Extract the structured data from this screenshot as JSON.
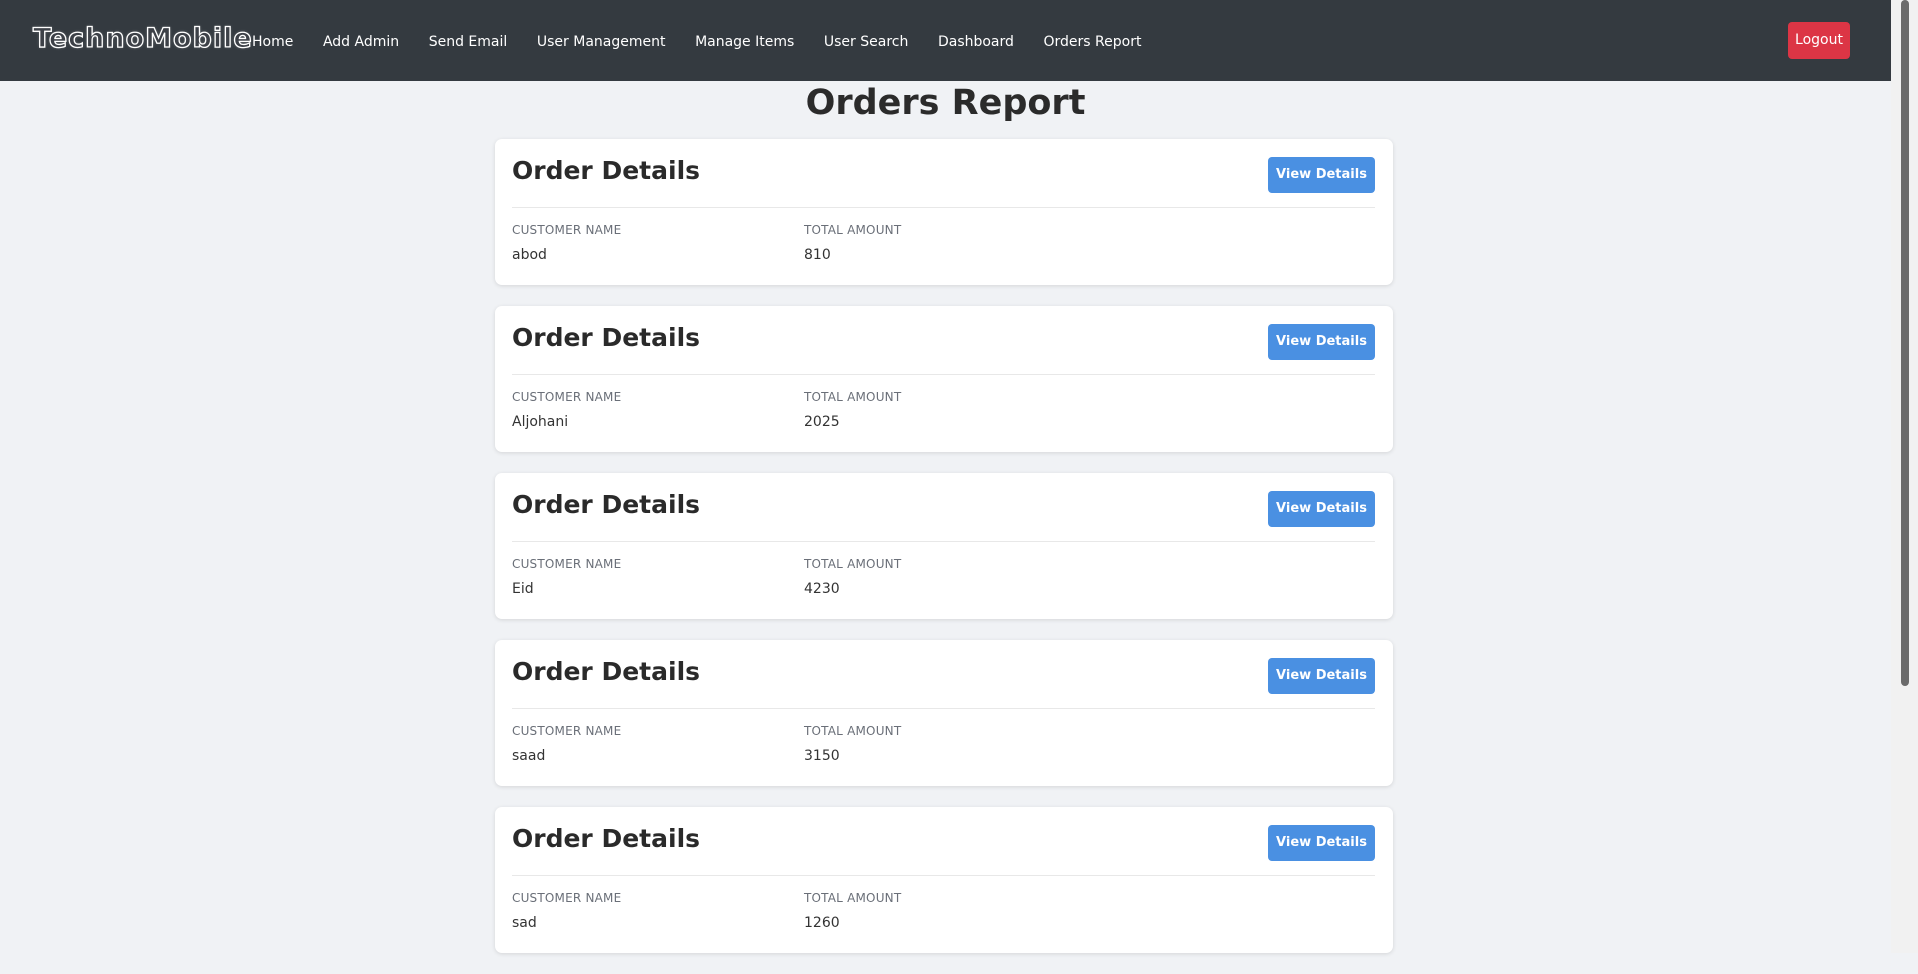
{
  "navbar": {
    "brand": "TechnoMobile",
    "links": [
      "Home",
      "Add Admin",
      "Send Email",
      "User Management",
      "Manage Items",
      "User Search",
      "Dashboard",
      "Orders Report"
    ],
    "logout_label": "Logout"
  },
  "page": {
    "title": "Orders Report"
  },
  "orders": [
    {
      "title": "Order Details",
      "button": "View Details",
      "customer_label": "CUSTOMER NAME",
      "customer": "abod",
      "amount_label": "TOTAL AMOUNT",
      "amount": "810"
    },
    {
      "title": "Order Details",
      "button": "View Details",
      "customer_label": "CUSTOMER NAME",
      "customer": "Aljohani",
      "amount_label": "TOTAL AMOUNT",
      "amount": "2025"
    },
    {
      "title": "Order Details",
      "button": "View Details",
      "customer_label": "CUSTOMER NAME",
      "customer": "Eid",
      "amount_label": "TOTAL AMOUNT",
      "amount": "4230"
    },
    {
      "title": "Order Details",
      "button": "View Details",
      "customer_label": "CUSTOMER NAME",
      "customer": "saad",
      "amount_label": "TOTAL AMOUNT",
      "amount": "3150"
    },
    {
      "title": "Order Details",
      "button": "View Details",
      "customer_label": "CUSTOMER NAME",
      "customer": "sad",
      "amount_label": "TOTAL AMOUNT",
      "amount": "1260"
    }
  ],
  "colors": {
    "navbar_bg": "#343a40",
    "page_bg": "#f0f2f5",
    "primary_button": "#4a90e2",
    "logout_button": "#dc3545"
  }
}
